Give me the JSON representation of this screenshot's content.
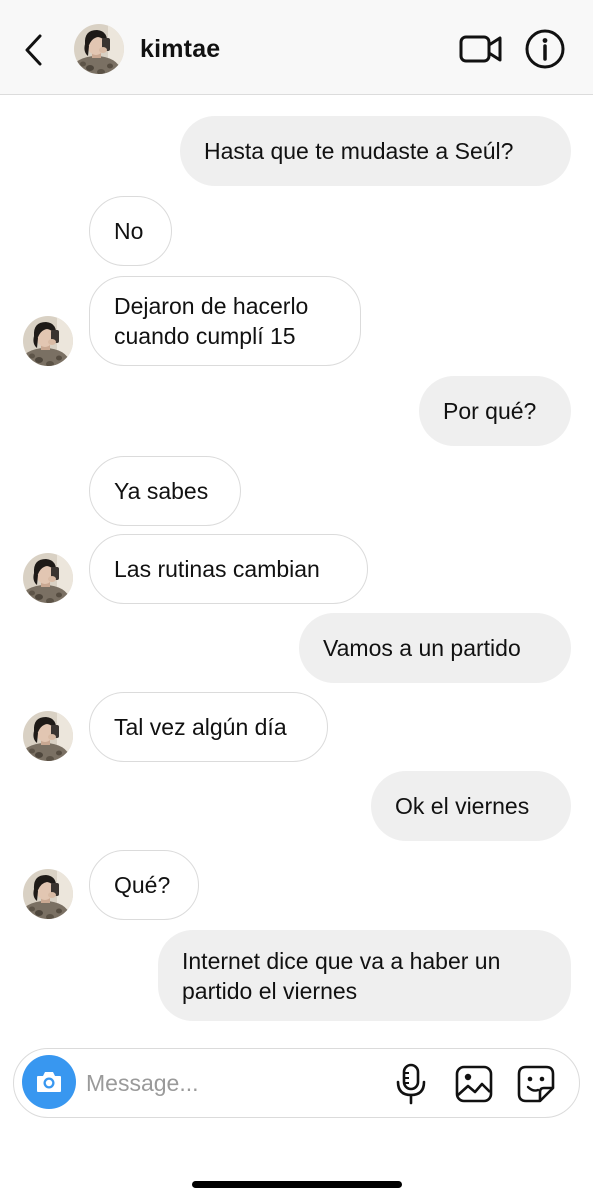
{
  "header": {
    "username": "kimtae"
  },
  "messages": [
    {
      "from": "me",
      "lines": [
        "Hasta que te mudaste a Seúl?"
      ]
    },
    {
      "from": "them",
      "lines": [
        "No"
      ]
    },
    {
      "from": "them",
      "lines": [
        "Dejaron de hacerlo",
        "cuando cumplí 15"
      ]
    },
    {
      "from": "me",
      "lines": [
        "Por qué?"
      ]
    },
    {
      "from": "them",
      "lines": [
        "Ya sabes"
      ]
    },
    {
      "from": "them",
      "lines": [
        "Las rutinas cambian"
      ]
    },
    {
      "from": "me",
      "lines": [
        "Vamos a un partido"
      ]
    },
    {
      "from": "them",
      "lines": [
        "Tal vez algún día"
      ]
    },
    {
      "from": "me",
      "lines": [
        "Ok el viernes"
      ]
    },
    {
      "from": "them",
      "lines": [
        "Qué?"
      ]
    },
    {
      "from": "me",
      "lines": [
        "Internet dice que va a haber un",
        "partido el viernes"
      ]
    }
  ],
  "composer": {
    "placeholder": "Message..."
  },
  "icons": {
    "back": "chevron-left-icon",
    "video": "video-camera-icon",
    "info": "info-icon",
    "camera": "camera-icon",
    "mic": "microphone-icon",
    "gallery": "image-icon",
    "sticker": "sticker-icon"
  },
  "colors": {
    "outgoing_bubble": "#efefef",
    "incoming_border": "#dbdbdb",
    "camera_button": "#3897f0",
    "header_bg": "#f8f8f8"
  }
}
